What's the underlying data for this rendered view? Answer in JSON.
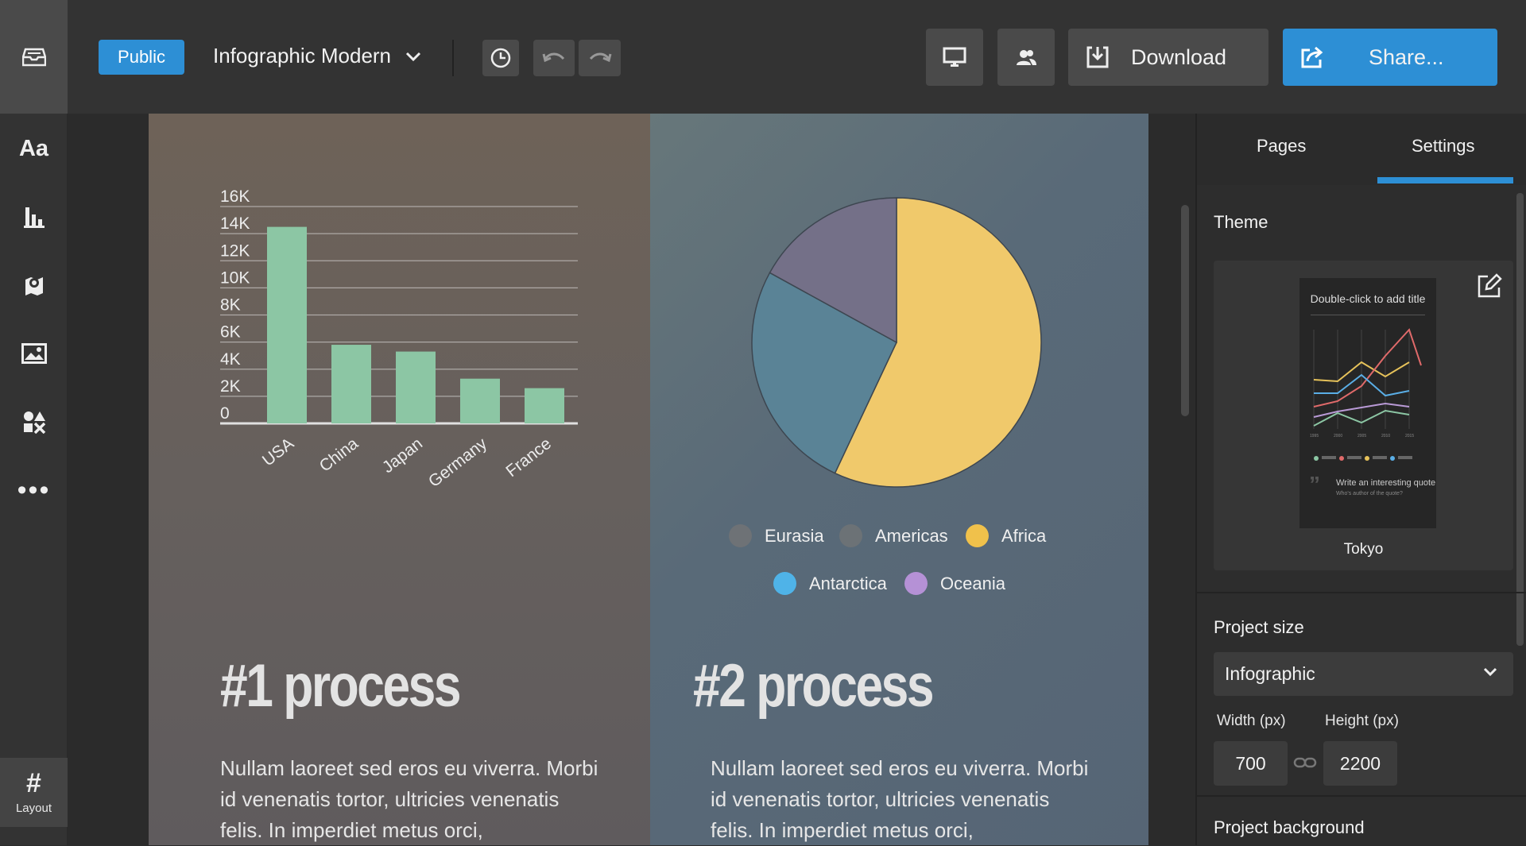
{
  "topbar": {
    "visibility_button": "Public",
    "project_title": "Infographic Modern",
    "download_label": "Download",
    "share_label": "Share..."
  },
  "rail": {
    "layout_label": "Layout"
  },
  "chart_data": [
    {
      "type": "bar",
      "categories": [
        "USA",
        "China",
        "Japan",
        "Germany",
        "France"
      ],
      "values": [
        14.5,
        5.8,
        5.3,
        3.3,
        2.6
      ],
      "ytick_labels": [
        "0",
        "2K",
        "4K",
        "6K",
        "8K",
        "10K",
        "12K",
        "14K",
        "16K"
      ],
      "ylim": [
        0,
        16
      ],
      "grid": true,
      "bar_color": "#8cc6a4"
    },
    {
      "type": "pie",
      "slices": [
        {
          "label": "Africa",
          "value": 57,
          "color": "#f0c96b"
        },
        {
          "label": "Americas",
          "value": 26,
          "color": "#5a8396"
        },
        {
          "label": "Eurasia",
          "value": 17,
          "color": "#747088"
        }
      ],
      "legend": [
        {
          "label": "Eurasia",
          "color": "#6e7276"
        },
        {
          "label": "Americas",
          "color": "#6c7276"
        },
        {
          "label": "Africa",
          "color": "#f0c14b"
        },
        {
          "label": "Antarctica",
          "color": "#4fb3e8"
        },
        {
          "label": "Oceania",
          "color": "#b591d6"
        }
      ],
      "legend_placement": "bottom"
    }
  ],
  "content": {
    "left_title": "#1 process",
    "left_body": "Nullam laoreet sed eros eu viverra. Morbi id venenatis tortor, ultricies venenatis felis. In imperdiet metus orci,",
    "right_title": "#2 process",
    "right_body": "Nullam laoreet sed eros eu viverra. Morbi id venenatis tortor, ultricies venenatis felis. In imperdiet metus orci,"
  },
  "sidebar": {
    "tabs": [
      {
        "label": "Pages",
        "active": false
      },
      {
        "label": "Settings",
        "active": true
      }
    ],
    "theme_label": "Theme",
    "theme_preview_title": "Double-click to add title",
    "theme_preview_quote": "Write an interesting quote",
    "theme_preview_quote_sub": "Who's author of the quote?",
    "theme_name": "Tokyo",
    "project_size_label": "Project size",
    "project_size_value": "Infographic",
    "width_label": "Width (px)",
    "height_label": "Height (px)",
    "width_value": "700",
    "height_value": "2200",
    "project_background_label": "Project background"
  },
  "colors": {
    "accent": "#2d8fd5"
  }
}
